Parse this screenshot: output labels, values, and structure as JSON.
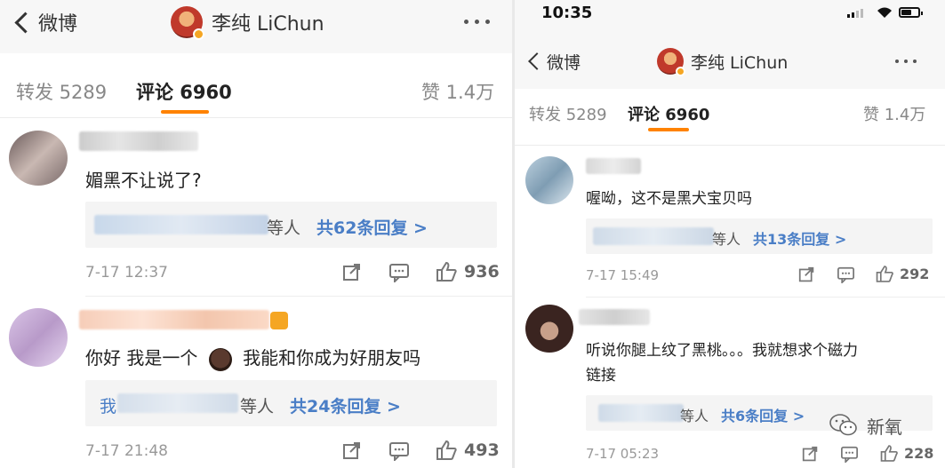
{
  "left": {
    "header": {
      "back_label": "微博",
      "title": "李纯 LiChun"
    },
    "tabs": {
      "repost": "转发 5289",
      "comments": "评论 6960",
      "likes": "赞 1.4万"
    },
    "comments": [
      {
        "text": "媚黑不让说了?",
        "reply_users_suffix": "等人",
        "reply_count": "共62条回复 >",
        "time": "7-17 12:37",
        "likes": "936"
      },
      {
        "text_before": "你好 我是一个",
        "text_after": "我能和你成为好朋友吗",
        "reply_users_prefix": "我",
        "reply_users_suffix": "等人",
        "reply_count": "共24条回复 >",
        "time": "7-17 21:48",
        "likes": "493"
      }
    ]
  },
  "right": {
    "status": {
      "time": "10:35"
    },
    "header": {
      "back_label": "微博",
      "title": "李纯 LiChun"
    },
    "tabs": {
      "repost": "转发 5289",
      "comments": "评论 6960",
      "likes": "赞 1.4万"
    },
    "comments": [
      {
        "text": "喔呦，这不是黑犬宝贝吗",
        "reply_users_suffix": "等人",
        "reply_count": "共13条回复 >",
        "time": "7-17 15:49",
        "likes": "292"
      },
      {
        "text_line1": "听说你腿上纹了黑桃。。。我就想求个磁力",
        "text_line2": "链接",
        "reply_users_suffix": "等人",
        "reply_count": "共6条回复 >",
        "time": "7-17 05:23",
        "likes": "228"
      }
    ],
    "watermark": "新氧"
  },
  "colors": {
    "accent": "#ff8200",
    "link": "#4a7ec6"
  },
  "icons": [
    "chevron-left-icon",
    "more-icon",
    "share-icon",
    "comment-icon",
    "like-icon",
    "signal-icon",
    "wifi-icon",
    "battery-icon",
    "verified-icon",
    "crown-icon",
    "wechat-icon"
  ]
}
